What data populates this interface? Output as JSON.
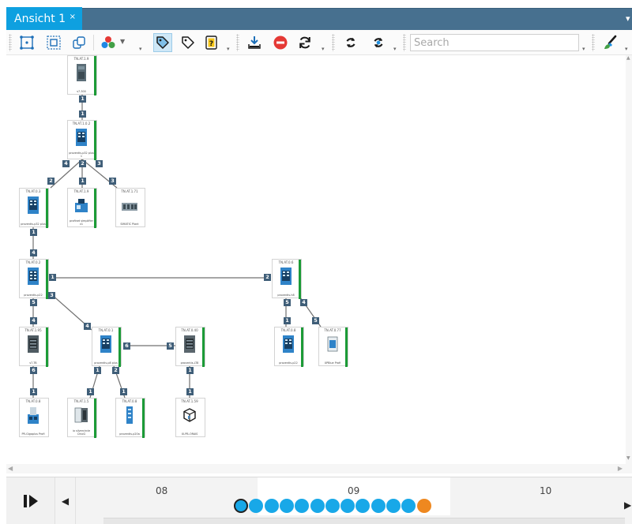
{
  "tab": {
    "title": "Ansicht 1",
    "close_glyph": "×"
  },
  "toolbar": {
    "search_placeholder": "Search",
    "icons": [
      "select-all-icon",
      "group-icon",
      "copy-icon",
      "colors-icon",
      "tag-icon",
      "tag-outline-icon",
      "help-label-icon",
      "download-icon",
      "stop-icon",
      "refresh-icon",
      "sync-icon",
      "sync-blue-icon",
      "brush-icon"
    ]
  },
  "nodes": [
    {
      "id": "n1",
      "top": "TN.AT.1.9",
      "bottom": "s7-300",
      "kind": "plc"
    },
    {
      "id": "n2",
      "top": "TN.AT.1.0.2",
      "bottom": "proventis-p32 plus 1",
      "kind": "switch"
    },
    {
      "id": "n3",
      "top": "TN.AT.0.3",
      "bottom": "proventis-p32 plus",
      "kind": "switch"
    },
    {
      "id": "n4",
      "top": "TN.AT.1.9",
      "bottom": "profinet simplifier v1",
      "kind": "device"
    },
    {
      "id": "n5",
      "top": "TN.AT.1.71",
      "bottom": "SIMATIC Plant",
      "kind": "rack"
    },
    {
      "id": "n6",
      "top": "TN.AT.0.2",
      "bottom": "proventis-p22",
      "kind": "switch"
    },
    {
      "id": "n7",
      "top": "TN.AT.0.6",
      "bottom": "proventis-h8",
      "kind": "switch"
    },
    {
      "id": "n8",
      "top": "TN.AT.1.95",
      "bottom": "s7-TB",
      "kind": "io"
    },
    {
      "id": "n9",
      "top": "TN.AT.0.1",
      "bottom": "proventis-p8 plus",
      "kind": "switch"
    },
    {
      "id": "n10",
      "top": "TN.AT.0.40",
      "bottom": "proventis-LT8",
      "kind": "io"
    },
    {
      "id": "n11",
      "top": "TN.AT.0.8",
      "bottom": "proventis-p22",
      "kind": "switch"
    },
    {
      "id": "n12",
      "top": "TN.AT.0.77",
      "bottom": "XPBlue Profi",
      "kind": "device"
    },
    {
      "id": "n13",
      "top": "TN.AT.0.8",
      "bottom": "PR-Gigaplus Profi",
      "kind": "device"
    },
    {
      "id": "n14",
      "top": "TN.AT.1.5",
      "bottom": "io silvercircle ChioG",
      "kind": "io"
    },
    {
      "id": "n15",
      "top": "TN.AT.0.8",
      "bottom": "proventis-p20a",
      "kind": "rail"
    },
    {
      "id": "n16",
      "top": "TN.AT.1.59",
      "bottom": "XI-PB-ORAIS",
      "kind": "cube"
    }
  ],
  "ports": [
    "1",
    "1",
    "4",
    "2",
    "2",
    "1",
    "3",
    "3",
    "1",
    "4",
    "1",
    "2",
    "5",
    "3",
    "4",
    "4",
    "5",
    "1",
    "4",
    "5",
    "6",
    "5",
    "1",
    "2",
    "1",
    "1",
    "1",
    "6",
    "1",
    "1",
    "1"
  ],
  "timeline": {
    "labels": [
      "08",
      "09",
      "10"
    ],
    "dots": 13,
    "orange_dot_index": 12
  },
  "colors": {
    "tab": "#0ea0e0",
    "tabstrip": "#47708f",
    "status_bar": "#1c9b37",
    "port": "#3f5e78",
    "dot": "#18a8e8",
    "dot_last": "#ee8820"
  }
}
